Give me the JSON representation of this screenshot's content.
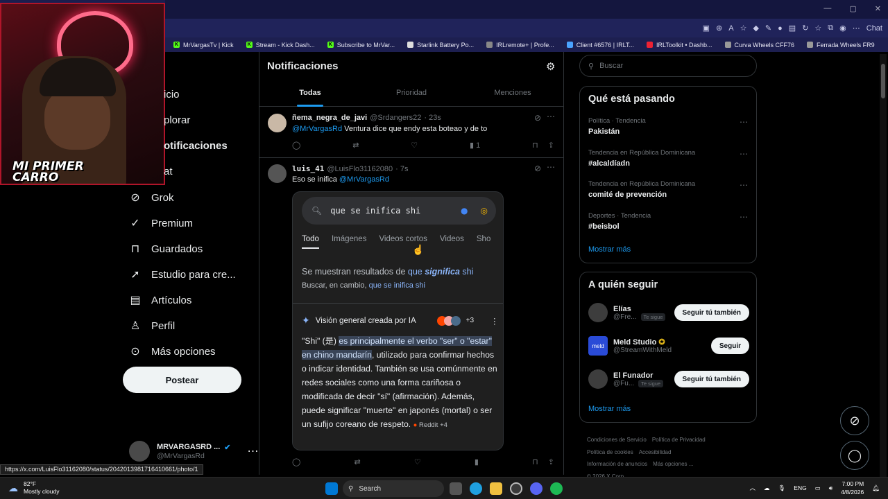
{
  "browser": {
    "chat_label": "Chat",
    "bookmarks": [
      "MrVargasTv | Kick",
      "Stream - Kick Dash...",
      "Subscribe to MrVar...",
      "Starlink Battery Po...",
      "IRLremote+ | Profe...",
      "Client #6576 | IRLT...",
      "IRLToolkit • Dashb...",
      "Curva Wheels CFF76",
      "Ferrada Wheels FR9"
    ],
    "status_url": "https://x.com/LuisFlo31162080/status/2042013981716410661/photo/1"
  },
  "webcam": {
    "overlay_text": "MI PRIMER\nCARRO"
  },
  "nav": {
    "partial_items": [
      "icio",
      "plorar",
      "otificaciones",
      "at"
    ],
    "items": [
      "Grok",
      "Premium",
      "Guardados",
      "Estudio para cre...",
      "Artículos",
      "Perfil",
      "Más opciones"
    ],
    "post_label": "Postear",
    "profile_name": "MRVARGASRD ...",
    "profile_handle": "@MrVargasRd"
  },
  "main": {
    "title": "Notificaciones",
    "tabs": [
      "Todas",
      "Prioridad",
      "Menciones"
    ],
    "tweets": [
      {
        "name": "ñema_negra_de_javi",
        "handle": "@Srdangers22",
        "time": "· 23s",
        "mention": "@MrVargasRd",
        "text": "Ventura dice que endy esta boteao y de to",
        "views": "1"
      },
      {
        "name": "luis_41",
        "handle": "@LuisFlo31162080",
        "time": "· 7s",
        "text": "Eso se inifica",
        "mention": "@MrVargasRd"
      }
    ]
  },
  "google": {
    "query": "que se inifica shi",
    "tabs": [
      "Todo",
      "Imágenes",
      "Videos cortos",
      "Videos",
      "Sho"
    ],
    "corr_prefix": "Se muestran resultados de",
    "corr_q": "que",
    "corr_bold": "significa",
    "corr_shi": "shi",
    "alt_prefix": "Buscar, en cambio,",
    "alt_link": "que se inifica shi",
    "ai_title": "Visión general creada por IA",
    "ai_count": "+3",
    "ai_p1": "\"Shi\" (是)",
    "ai_hl": "es principalmente el verbo \"ser\" o \"estar\" en chino mandarín",
    "ai_p2": ", utilizado para confirmar hechos o indicar identidad. También se usa comúnmente en redes sociales como una forma cariñosa o modificada de decir \"sí\" (afirmación). Además, puede significar \"muerte\" en japonés (mortal) o ser un sufijo coreano de respeto.",
    "ai_source": "Reddit +4"
  },
  "sidebar": {
    "search_placeholder": "Buscar",
    "trends_title": "Qué está pasando",
    "trends": [
      {
        "ctx": "Política · Tendencia",
        "title": "Pakistán"
      },
      {
        "ctx": "Tendencia en República Dominicana",
        "title": "#alcaldíadn"
      },
      {
        "ctx": "Tendencia en República Dominicana",
        "title": "comité de prevención"
      },
      {
        "ctx": "Deportes · Tendencia",
        "title": "#beisbol"
      }
    ],
    "show_more": "Mostrar más",
    "follow_title": "A quién seguir",
    "follow": [
      {
        "name": "Elías",
        "handle": "@Fre...",
        "badge": "Te sigue",
        "button": "Seguir tú también"
      },
      {
        "name": "Meld Studio",
        "handle": "@StreamWithMeld",
        "badge": "",
        "button": "Seguir"
      },
      {
        "name": "El Funador",
        "handle": "@Fu...",
        "badge": "Te sigue",
        "button": "Seguir tú también"
      }
    ],
    "footer": [
      "Condiciones de Servicio",
      "Política de Privacidad",
      "Política de cookies",
      "Accesibilidad",
      "Información de anuncios",
      "Más opciones ...",
      "© 2026 X Corp."
    ]
  },
  "taskbar": {
    "temp": "82°F",
    "weather": "Mostly cloudy",
    "search": "Search",
    "lang": "ENG",
    "time": "7:00 PM",
    "date": "4/8/2026"
  }
}
